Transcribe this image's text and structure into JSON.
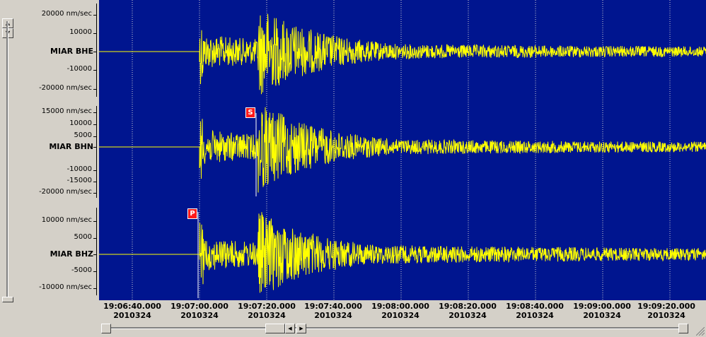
{
  "channels": [
    {
      "name": "MIAR BHE",
      "ticks": [
        "20000 nm/sec",
        "10000",
        "-10000",
        "-20000 nm/sec"
      ]
    },
    {
      "name": "MIAR BHN",
      "ticks": [
        "15000 nm/sec",
        "10000",
        "5000",
        "-10000",
        "-15000",
        "-20000 nm/sec"
      ]
    },
    {
      "name": "MIAR BHZ",
      "ticks": [
        "10000 nm/sec",
        "5000",
        "-5000",
        "-10000 nm/sec"
      ]
    }
  ],
  "time_axis": {
    "times": [
      "19:06:40.000",
      "19:07:00.000",
      "19:07:20.000",
      "19:07:40.000",
      "19:08:00.000",
      "19:08:20.000",
      "19:08:40.000",
      "19:09:00.000",
      "19:09:20.000"
    ],
    "date": "2010324"
  },
  "picks": {
    "s_label": "S",
    "p_label": "P"
  },
  "colors": {
    "background": "#00158f",
    "trace": "#ffff00",
    "grid": "#d0d0d0",
    "pick": "#ff1a1a"
  },
  "icons": {
    "scroll_up": "triangle-up",
    "scroll_down": "triangle-down",
    "scroll_left": "triangle-left",
    "scroll_right": "triangle-right"
  }
}
